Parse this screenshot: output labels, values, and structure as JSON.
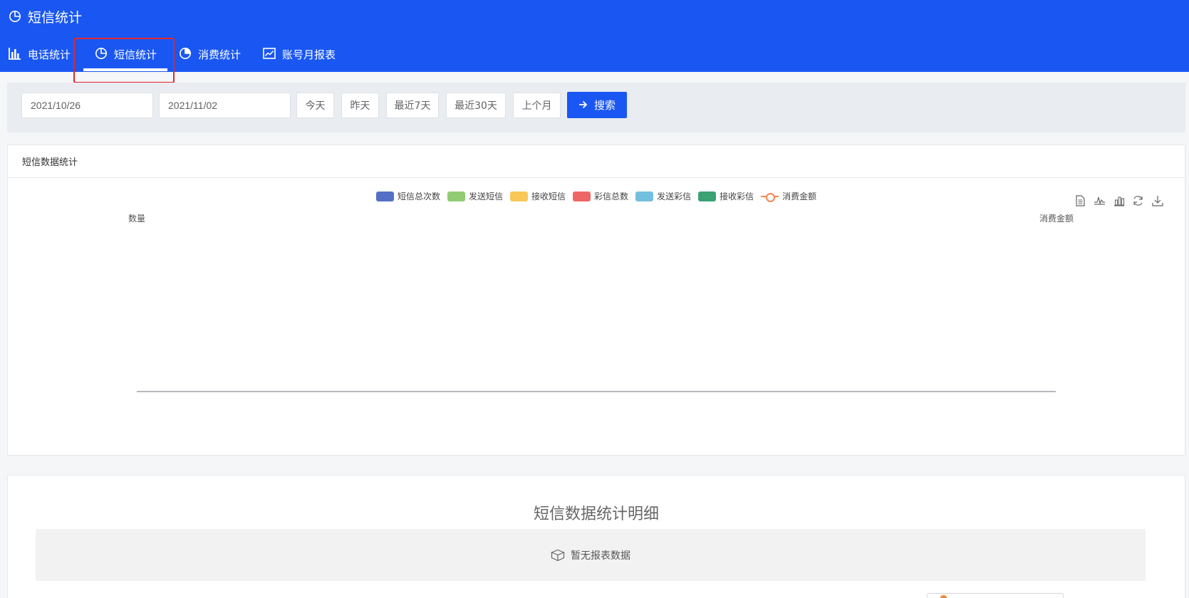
{
  "header": {
    "title": "短信统计",
    "tabs": [
      {
        "label": "电话统计",
        "icon": "bar-chart-icon",
        "active": false
      },
      {
        "label": "短信统计",
        "icon": "pie-chart-icon",
        "active": true
      },
      {
        "label": "消费统计",
        "icon": "pie-chart-icon",
        "active": false
      },
      {
        "label": "账号月报表",
        "icon": "line-chart-icon",
        "active": false
      }
    ]
  },
  "filter": {
    "start_date": "2021/10/26",
    "end_date": "2021/11/02",
    "quick": [
      "今天",
      "昨天",
      "最近7天",
      "最近30天",
      "上个月"
    ],
    "search_label": "搜索"
  },
  "chart_card": {
    "title": "短信数据统计"
  },
  "chart_data": {
    "type": "bar",
    "categories": [],
    "series": [
      {
        "name": "短信总次数",
        "type": "bar",
        "color": "#5470c6",
        "values": []
      },
      {
        "name": "发送短信",
        "type": "bar",
        "color": "#91cc75",
        "values": []
      },
      {
        "name": "接收短信",
        "type": "bar",
        "color": "#fac858",
        "values": []
      },
      {
        "name": "彩信总数",
        "type": "bar",
        "color": "#ee6666",
        "values": []
      },
      {
        "name": "发送彩信",
        "type": "bar",
        "color": "#73c0de",
        "values": []
      },
      {
        "name": "接收彩信",
        "type": "bar",
        "color": "#3ba272",
        "values": []
      },
      {
        "name": "消费金额",
        "type": "line",
        "color": "#fc8452",
        "values": []
      }
    ],
    "ylabel": "数量",
    "y2label": "消费金额",
    "legend": "top-center",
    "grid": false
  },
  "toolbox": [
    "data-view-icon",
    "line-switch-icon",
    "bar-switch-icon",
    "restore-icon",
    "download-icon"
  ],
  "detail": {
    "title": "短信数据统计明细",
    "empty_text": "暂无报表数据"
  },
  "colors": {
    "primary": "#1a57f2",
    "highlight_border": "#e3262a"
  }
}
